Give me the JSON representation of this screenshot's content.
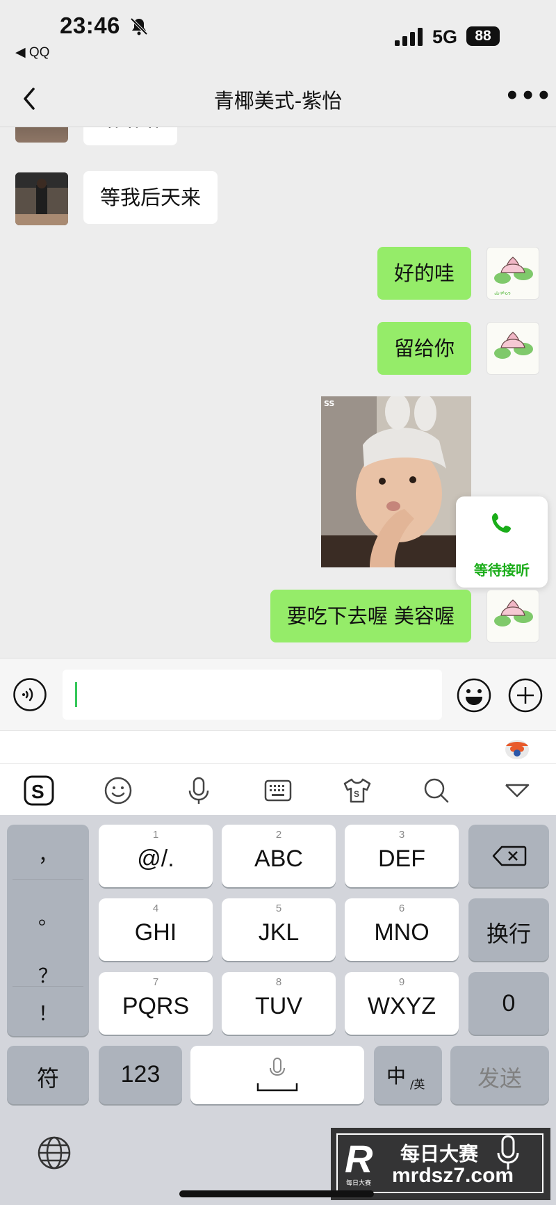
{
  "status_bar": {
    "time": "23:46",
    "back_app": "◀ QQ",
    "network": "5G",
    "battery": "88"
  },
  "nav": {
    "title": "青椰美式-紫怡"
  },
  "messages": [
    {
      "side": "left",
      "type": "text",
      "text": "哈哈哈"
    },
    {
      "side": "left",
      "type": "text",
      "text": "等我后天来"
    },
    {
      "side": "right",
      "type": "text",
      "text": "好的哇"
    },
    {
      "side": "right",
      "type": "text",
      "text": "留给你"
    },
    {
      "side": "right",
      "type": "image",
      "badge": "SS"
    },
    {
      "side": "right",
      "type": "text",
      "text": "要吃下去喔  美容喔"
    }
  ],
  "call_popup": {
    "label": "等待接听"
  },
  "input": {
    "value": ""
  },
  "keyboard": {
    "side_column": [
      "，",
      "。",
      "？",
      "！"
    ],
    "keys": [
      {
        "num": "1",
        "label": "@/."
      },
      {
        "num": "2",
        "label": "ABC"
      },
      {
        "num": "3",
        "label": "DEF"
      },
      {
        "num": "4",
        "label": "GHI"
      },
      {
        "num": "5",
        "label": "JKL"
      },
      {
        "num": "6",
        "label": "MNO"
      },
      {
        "num": "7",
        "label": "PQRS"
      },
      {
        "num": "8",
        "label": "TUV"
      },
      {
        "num": "9",
        "label": "WXYZ"
      }
    ],
    "newline_label": "换行",
    "zero_label": "0",
    "symbols_label": "符",
    "numbers_label": "123",
    "lang_label": "中",
    "lang_sub": "/英",
    "send_label": "发送"
  },
  "watermark": {
    "letter": "R",
    "cn": "每日大赛",
    "url": "mrdsz7.com",
    "sub": "每日大赛"
  },
  "colors": {
    "bubble_green": "#95ec69",
    "call_green": "#1aad19",
    "background": "#ededed"
  }
}
